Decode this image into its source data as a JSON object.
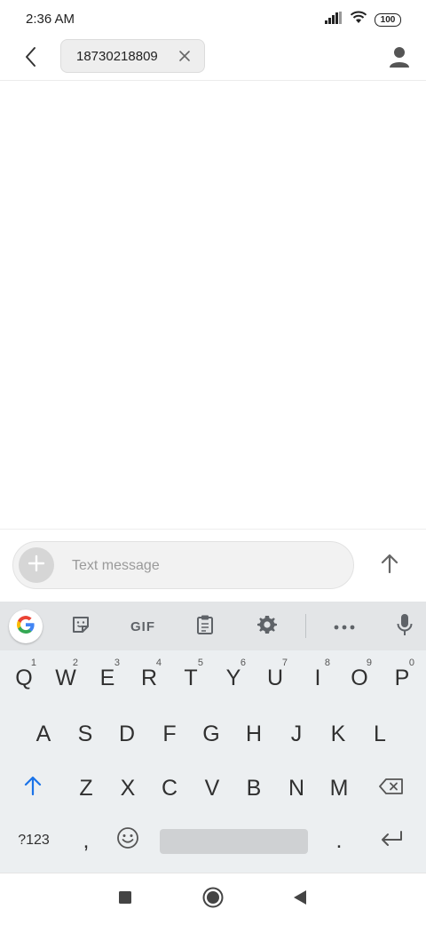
{
  "status_bar": {
    "time": "2:36 AM",
    "battery": "100",
    "icons": [
      "signal-icon",
      "wifi-icon",
      "battery-icon"
    ]
  },
  "app_bar": {
    "recipient": "18730218809",
    "icons": [
      "back-arrow-icon",
      "close-icon",
      "person-icon"
    ]
  },
  "compose": {
    "placeholder": "Text message",
    "value": "",
    "icons": [
      "plus-icon",
      "send-arrow-icon"
    ]
  },
  "keyboard": {
    "toolbar": {
      "items": [
        "google-icon",
        "sticker-icon",
        "GIF",
        "clipboard-icon",
        "gear-icon",
        "more-icon",
        "mic-icon"
      ],
      "gif_label": "GIF"
    },
    "row1": [
      {
        "key": "Q",
        "hint": "1"
      },
      {
        "key": "W",
        "hint": "2"
      },
      {
        "key": "E",
        "hint": "3"
      },
      {
        "key": "R",
        "hint": "4"
      },
      {
        "key": "T",
        "hint": "5"
      },
      {
        "key": "Y",
        "hint": "6"
      },
      {
        "key": "U",
        "hint": "7"
      },
      {
        "key": "I",
        "hint": "8"
      },
      {
        "key": "O",
        "hint": "9"
      },
      {
        "key": "P",
        "hint": "0"
      }
    ],
    "row2": [
      "A",
      "S",
      "D",
      "F",
      "G",
      "H",
      "J",
      "K",
      "L"
    ],
    "row3": [
      "Z",
      "X",
      "C",
      "V",
      "B",
      "N",
      "M"
    ],
    "row4": {
      "symbols": "?123",
      "comma": ",",
      "period": "."
    },
    "accent_color": "#1a73e8"
  },
  "nav_bar": {
    "icons": [
      "recents-square-icon",
      "home-circle-icon",
      "back-triangle-icon"
    ]
  }
}
